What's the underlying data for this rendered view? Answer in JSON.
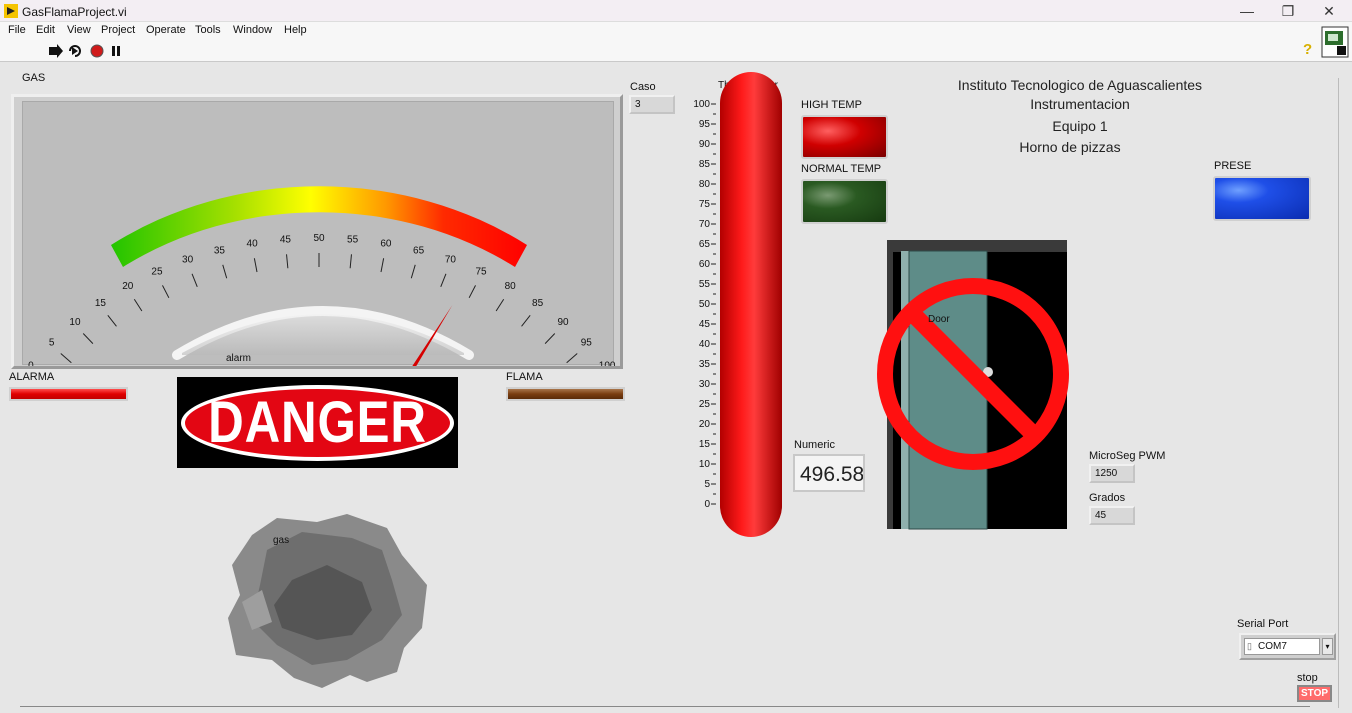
{
  "window": {
    "title": "GasFlamaProject.vi",
    "minimize": "—",
    "restore": "❐",
    "close": "✕"
  },
  "menu": [
    "File",
    "Edit",
    "View",
    "Project",
    "Operate",
    "Tools",
    "Window",
    "Help"
  ],
  "toolbar": {
    "run": "run-arrow",
    "run_continuous": "run-continuous",
    "abort": "abort",
    "pause": "pause",
    "help": "?"
  },
  "gas": {
    "label": "GAS",
    "value": 73,
    "min": 0,
    "max": 100,
    "ticks": [
      "0",
      "5",
      "10",
      "15",
      "20",
      "25",
      "30",
      "35",
      "40",
      "45",
      "50",
      "55",
      "60",
      "65",
      "70",
      "75",
      "80",
      "85",
      "90",
      "95",
      "100"
    ],
    "alarm_label": "alarm"
  },
  "caso": {
    "label": "Caso",
    "value": "3"
  },
  "alarma": {
    "label": "ALARMA"
  },
  "flama": {
    "label": "FLAMA"
  },
  "danger": {
    "text": "DANGER"
  },
  "gas_cloud": {
    "label": "gas"
  },
  "thermometer": {
    "label": "Thermometer",
    "value": 100,
    "ticks": [
      "100",
      "95",
      "90",
      "85",
      "80",
      "75",
      "70",
      "65",
      "60",
      "55",
      "50",
      "45",
      "40",
      "35",
      "30",
      "25",
      "20",
      "15",
      "10",
      "5",
      "0"
    ]
  },
  "high_temp": {
    "label": "HIGH TEMP",
    "on": true
  },
  "normal_temp": {
    "label": "NORMAL TEMP",
    "on": false
  },
  "numeric": {
    "label": "Numeric",
    "value": "496.58"
  },
  "header": {
    "line1": "Instituto Tecnologico de Aguascalientes",
    "line2": "Instrumentacion",
    "line3": "Equipo 1",
    "line4": "Horno de pizzas"
  },
  "prese": {
    "label": "PRESE",
    "on": true
  },
  "door": {
    "label": "Door"
  },
  "microseg": {
    "label": "MicroSeg PWM",
    "value": "1250"
  },
  "grados": {
    "label": "Grados",
    "value": "45"
  },
  "serial": {
    "label": "Serial Port",
    "value": "COM7"
  },
  "stop": {
    "label": "stop",
    "button": "STOP"
  },
  "colors": {
    "accent_red": "#e00000",
    "led_green_off": "#1f4a1a",
    "led_blue": "#0a3fd6",
    "danger_red": "#e30613"
  }
}
